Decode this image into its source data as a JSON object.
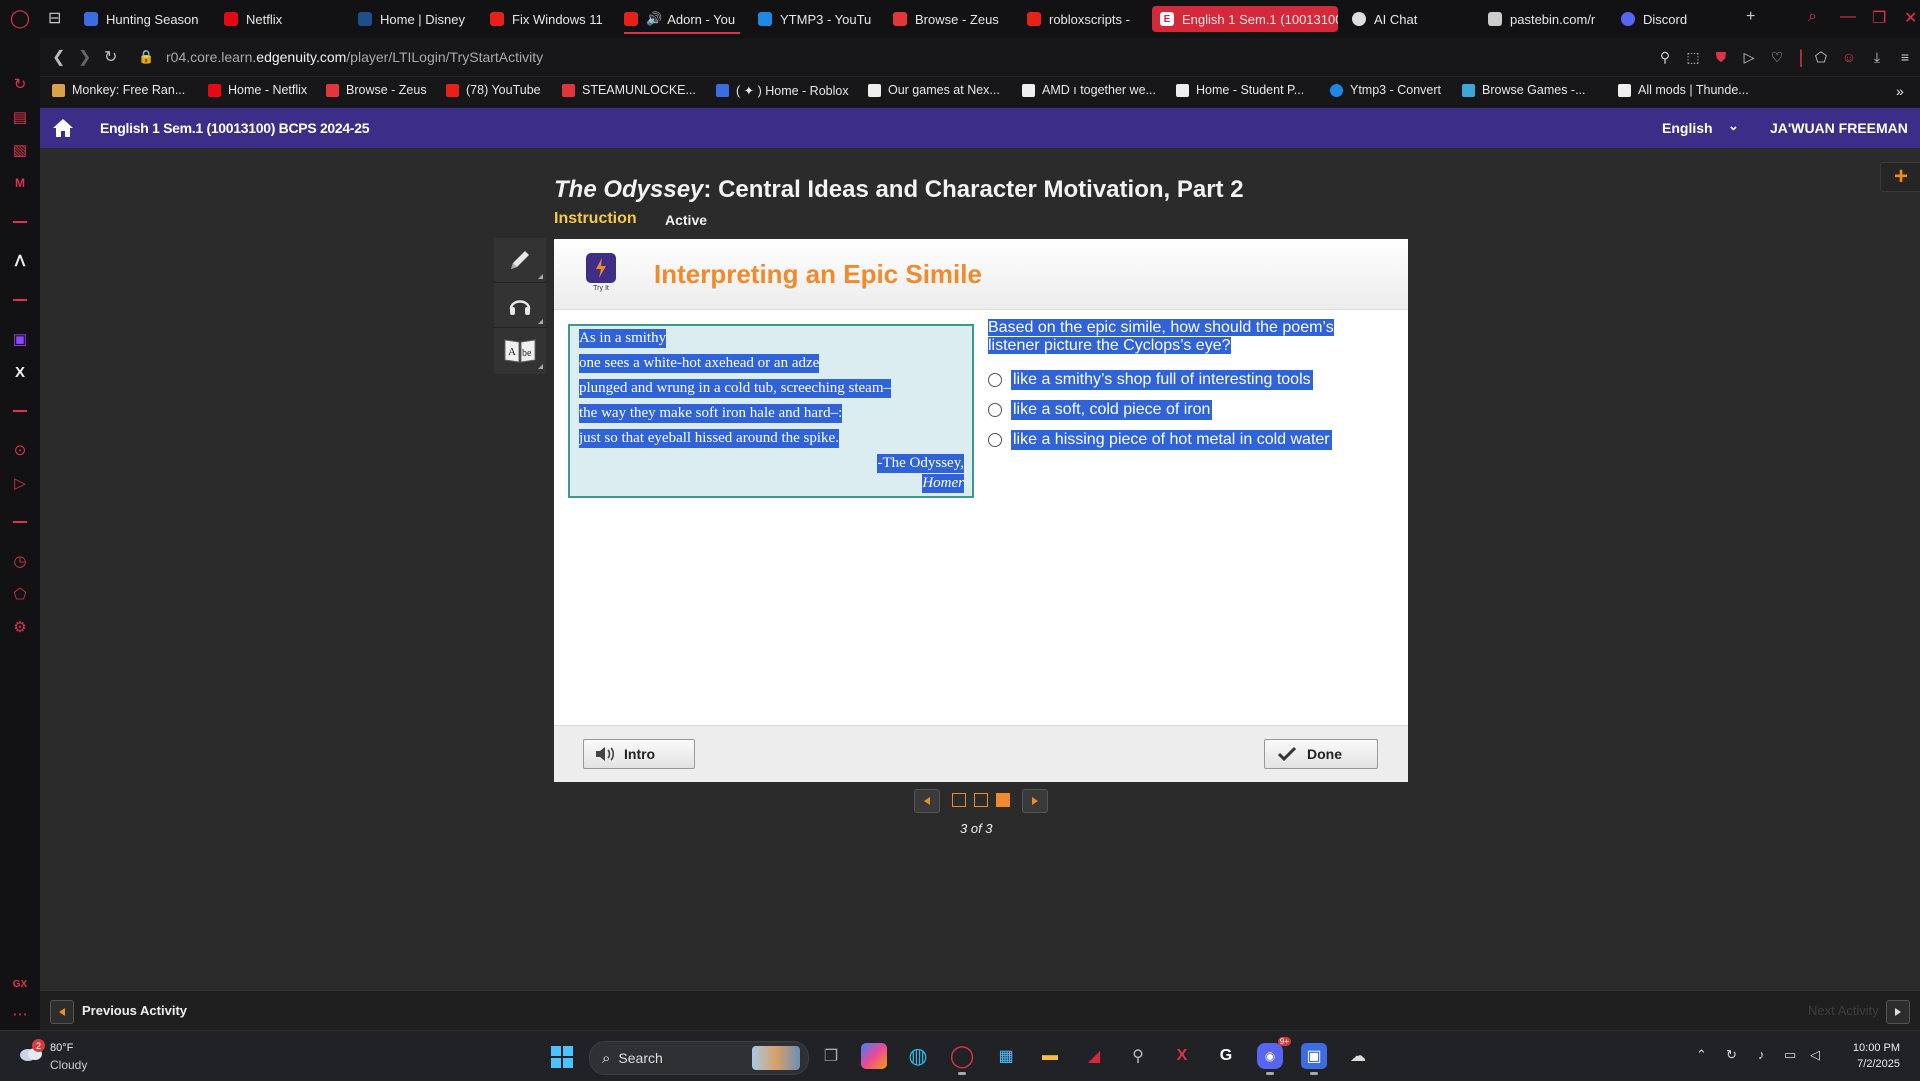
{
  "browser": {
    "tabs": [
      {
        "label": "Hunting Season",
        "color": "#3d6be0"
      },
      {
        "label": "Netflix",
        "color": "#e50914"
      },
      {
        "label": "Home | Disney",
        "color": "#1f4e8c"
      },
      {
        "label": "Fix Windows 11",
        "color": "#e62117"
      },
      {
        "label": "Adorn - You",
        "color": "#e62117"
      },
      {
        "label": "YTMP3 - YouTu",
        "color": "#1e88e5"
      },
      {
        "label": "Browse - Zeus",
        "color": "#e2373a"
      },
      {
        "label": "robloxscripts -",
        "color": "#e62117"
      },
      {
        "label": "English 1 Sem.1 (10013100",
        "color": "#ffffff"
      },
      {
        "label": "AI Chat",
        "color": "#dddddd"
      },
      {
        "label": "pastebin.com/r",
        "color": "#cccccc"
      },
      {
        "label": "Discord",
        "color": "#5865f2"
      }
    ],
    "new_tab": "+",
    "url_prefix": "r04.core.learn.",
    "url_domain": "edgenuity.com",
    "url_path": "/player/LTILogin/TryStartActivity",
    "bookmarks": [
      {
        "label": "Monkey: Free Ran...",
        "color": "#d8a14a"
      },
      {
        "label": "Home - Netflix",
        "color": "#e50914"
      },
      {
        "label": "Browse - Zeus",
        "color": "#e2373a"
      },
      {
        "label": "(78) YouTube",
        "color": "#e62117"
      },
      {
        "label": "STEAMUNLOCKE...",
        "color": "#e2373a"
      },
      {
        "label": "( ✦ ) Home - Roblox",
        "color": "#3d6be0"
      },
      {
        "label": "Our games at Nex...",
        "color": "#eeeeee"
      },
      {
        "label": "AMD ı together we...",
        "color": "#eeeeee"
      },
      {
        "label": "Home - Student P...",
        "color": "#eeeeee"
      },
      {
        "label": "Ytmp3 - Convert",
        "color": "#1e88e5"
      },
      {
        "label": "Browse Games -...",
        "color": "#3ba7d8"
      },
      {
        "label": "All mods | Thunde...",
        "color": "#eeeeee"
      }
    ]
  },
  "course": {
    "title": "English 1 Sem.1 (10013100) BCPS 2024-25",
    "language": "English",
    "user": "JA'WUAN FREEMAN",
    "brand_color": "#3c2e88"
  },
  "activity": {
    "title_italic": "The Odyssey",
    "title_rest": ": Central Ideas and Character Motivation, Part 2",
    "section": "Instruction",
    "status": "Active",
    "tryit_label": "Try It",
    "heading": "Interpreting an Epic Simile",
    "passage": {
      "lines": [
        "As in a smithy",
        "one sees a white-hot axehead or an adze",
        "plunged and wrung in a cold tub, screeching steam–",
        "the way they make soft iron hale and hard–:",
        "just so that eyeball hissed around the spike."
      ],
      "attribution_1": "-The Odyssey,",
      "attribution_2": "Homer"
    },
    "question": "Based on the epic simile, how should the poem’s listener picture the Cyclops’s eye?",
    "choices": [
      "like a smithy’s shop full of interesting tools",
      "like a soft, cold piece of iron",
      "like a hissing piece of hot metal in cold water"
    ],
    "intro_button": "Intro",
    "done_button": "Done",
    "pager": {
      "current": 3,
      "total": 3,
      "label": "3 of 3"
    },
    "accent_color": "#f08a2a",
    "selection_color": "#3063d8"
  },
  "navigation": {
    "previous": "Previous Activity",
    "next": "Next Activity"
  },
  "taskbar": {
    "weather_temp": "80°F",
    "weather_condition": "Cloudy",
    "weather_badge": "2",
    "search_placeholder": "Search",
    "discord_badge": "9+",
    "time": "10:00 PM",
    "date": "7/2/2025"
  }
}
